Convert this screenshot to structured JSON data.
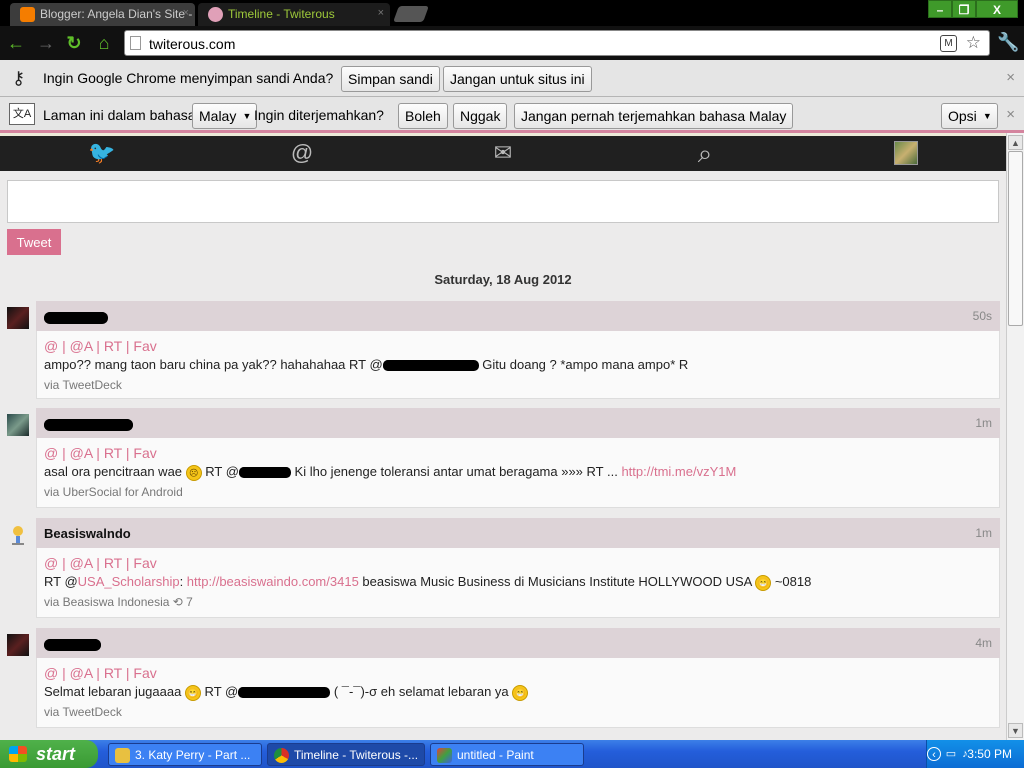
{
  "browser": {
    "tabs": [
      {
        "label": "Blogger: Angela Dian's Site - E",
        "active": false
      },
      {
        "label": "Timeline - Twiterous",
        "active": true
      }
    ],
    "close_glyph": "×",
    "window_buttons": {
      "minimize": "–",
      "restore": "❐",
      "close": "X"
    },
    "nav": {
      "back": "←",
      "forward": "→",
      "reload": "↻",
      "home": "⌂"
    },
    "url": "twiterous.com",
    "ext_label": "M",
    "star": "☆",
    "wrench": "🔧"
  },
  "password_bar": {
    "icon": "key-icon",
    "text": "Ingin Google Chrome menyimpan sandi Anda?",
    "save_label": "Simpan sandi",
    "never_label": "Jangan untuk situs ini"
  },
  "translate_bar": {
    "icon": "translate-icon",
    "text_prefix": "Laman ini dalam bahasa",
    "language": "Malay",
    "question": "Ingin diterjemahkan?",
    "yes_label": "Boleh",
    "no_label": "Nggak",
    "never_label": "Jangan pernah terjemahkan bahasa Malay",
    "options_label": "Opsi"
  },
  "site_nav": {
    "home_glyph": "🐦",
    "mentions_glyph": "@",
    "messages_glyph": "✉",
    "search_glyph": "⌕"
  },
  "composer": {
    "placeholder": "",
    "tweet_label": "Tweet"
  },
  "date_header": "Saturday, 18 Aug 2012",
  "tweets": [
    {
      "user": "██████████",
      "time": "50s",
      "actions": "@ | @A | RT | Fav",
      "text_before": "ampo?? mang taon baru china pa yak?? hahahahaa RT @",
      "redacted": "████████████",
      "text_after": " Gitu doang ? *ampo mana ampo* R",
      "via": "via TweetDeck"
    },
    {
      "user": "██████████████",
      "time": "1m",
      "actions": "@ | @A | RT | Fav",
      "text_before": "asal ora pencitraan wae ",
      "emoji": "☹",
      "text_mid": " RT @",
      "redacted": "████████",
      "text_after": " Ki lho jenenge toleransi antar umat beragama »»» RT ... ",
      "link": "http://tmi.me/vzY1M",
      "via": "via UberSocial for Android"
    },
    {
      "user": "Beasiswalndo",
      "time": "1m",
      "actions": "@ | @A | RT | Fav",
      "text_before": "RT @",
      "mention": "USA_Scholarship",
      "text_mid": ": ",
      "link": "http://beasiswaindo.com/3415",
      "text_after": " beasiswa Music Business di Musicians Institute HOLLYWOOD USA ",
      "emoji": "😁",
      "text_end": " ~0818",
      "via": "via Beasiswa Indonesia",
      "retweet_glyph": "⟲",
      "retweets": "7"
    },
    {
      "user": "█████████",
      "time": "4m",
      "actions": "@ | @A | RT | Fav",
      "text_before": "Selmat lebaran jugaaaa ",
      "emoji": "😁",
      "text_mid": " RT @",
      "redacted": "████████████",
      "text_after": " ( ¯-¯)-σ eh selamat lebaran ya ",
      "emoji2": "😁",
      "via": "via TweetDeck"
    }
  ],
  "taskbar": {
    "start_label": "start",
    "tasks": [
      {
        "label": "3. Katy Perry - Part ...",
        "active": false
      },
      {
        "label": "Timeline - Twiterous -...",
        "active": true
      },
      {
        "label": "untitled - Paint",
        "active": false
      }
    ],
    "tray_arrow": "‹",
    "tray_monitor": "▭",
    "tray_volume": "♪",
    "clock": "3:50 PM"
  }
}
